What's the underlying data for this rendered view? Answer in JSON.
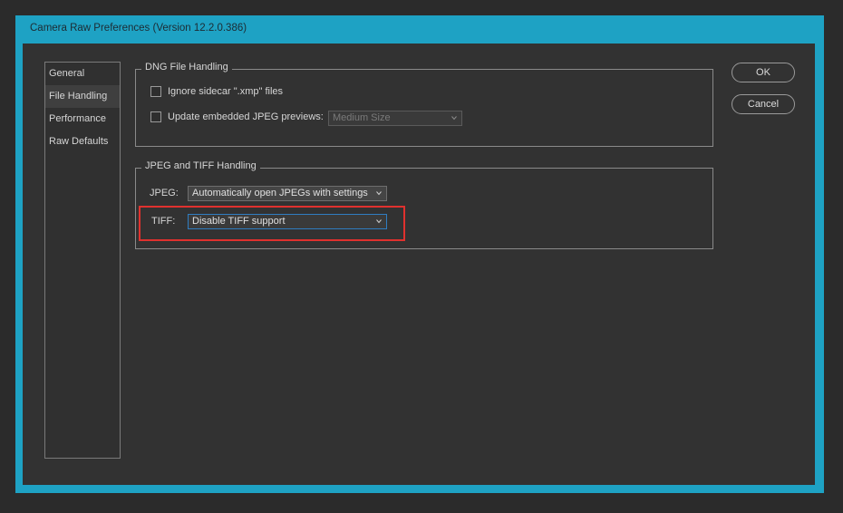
{
  "window": {
    "title": "Camera Raw Preferences  (Version 12.2.0.386)"
  },
  "sidebar": {
    "items": [
      {
        "label": "General",
        "selected": false
      },
      {
        "label": "File Handling",
        "selected": true
      },
      {
        "label": "Performance",
        "selected": false
      },
      {
        "label": "Raw Defaults",
        "selected": false
      }
    ]
  },
  "dng": {
    "title": "DNG File Handling",
    "ignore_sidecar_label": "Ignore sidecar \".xmp\" files",
    "ignore_sidecar_checked": false,
    "update_jpeg_label": "Update embedded JPEG previews:",
    "update_jpeg_checked": false,
    "preview_size_value": "Medium Size"
  },
  "jpeg_tiff": {
    "title": "JPEG and TIFF Handling",
    "jpeg_label": "JPEG:",
    "jpeg_value": "Automatically open JPEGs with settings",
    "tiff_label": "TIFF:",
    "tiff_value": "Disable TIFF support"
  },
  "buttons": {
    "ok": "OK",
    "cancel": "Cancel"
  },
  "colors": {
    "window_border": "#1ea2c4",
    "highlight": "#e0312e",
    "focus": "#2f7dc1"
  }
}
